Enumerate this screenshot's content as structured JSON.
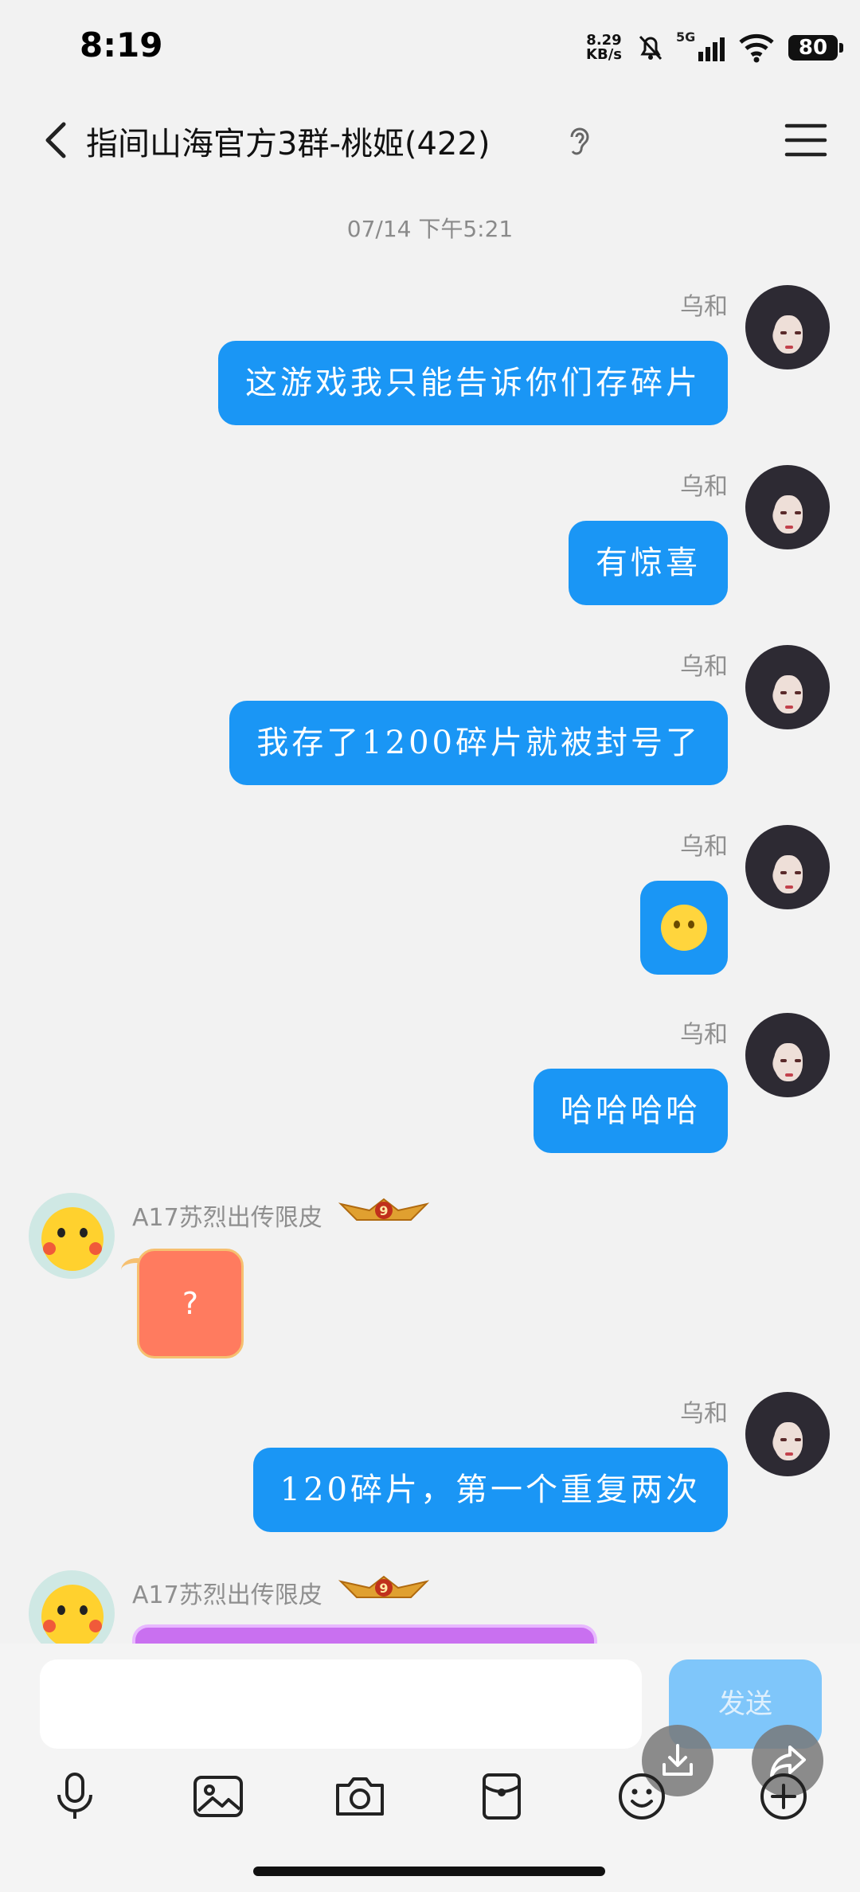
{
  "status_bar": {
    "time": "8:19",
    "net_speed_value": "8.29",
    "net_speed_unit": "KB/s",
    "signal": "5G",
    "battery": "80"
  },
  "header": {
    "title": "指间山海官方3群-桃姬(422)"
  },
  "chat": {
    "date_stamp": "07/14 下午5:21",
    "messages": [
      {
        "sender": "乌和",
        "text": "这游戏我只能告诉你们存碎片"
      },
      {
        "sender": "乌和",
        "text": "有惊喜"
      },
      {
        "sender": "乌和",
        "text": "我存了1200碎片就被封号了"
      },
      {
        "sender": "乌和",
        "text": ""
      },
      {
        "sender": "乌和",
        "text": "哈哈哈哈"
      },
      {
        "sender": "A17苏烈出传限皮",
        "text": "?"
      },
      {
        "sender": "乌和",
        "text": "120碎片，第一个重复两次"
      },
      {
        "sender": "A17苏烈出传限皮",
        "text": ""
      }
    ],
    "badge_level": "9"
  },
  "composer": {
    "input_value": "",
    "send_label": "发送"
  },
  "colors": {
    "bubble_self": "#1a96f5",
    "send_button": "#7fc6fa",
    "background": "#f2f2f2"
  }
}
